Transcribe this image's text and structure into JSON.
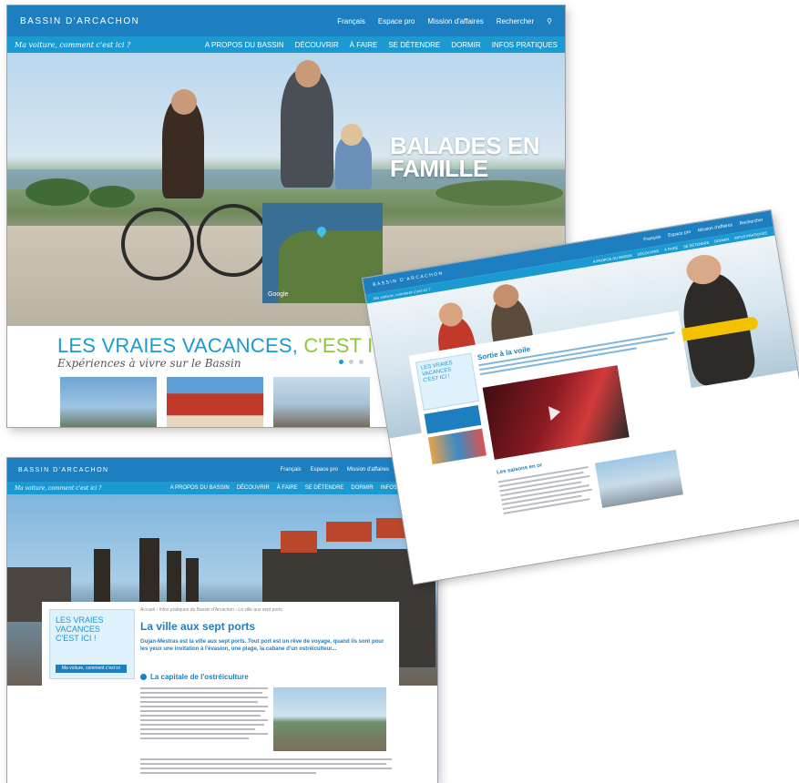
{
  "site": {
    "logo": "BASSIN D'ARCACHON",
    "utils": [
      "Français",
      "Espace pro",
      "Mission d'affaires",
      "Rechercher"
    ],
    "tagline": "Ma voiture, comment c'est ici ?",
    "nav": [
      "A PROPOS DU BASSIN",
      "DÉCOUVRIR",
      "À FAIRE",
      "SE DÉTENDRE",
      "DORMIR",
      "INFOS PRATIQUES"
    ]
  },
  "home": {
    "hero_line1": "BALADES EN",
    "hero_line2": "FAMILLE",
    "map_label": "Google",
    "title_main": "LES VRAIES VACANCES, ",
    "title_accent": "C'EST ICI !",
    "subtitle": "Expériences à vivre sur le Bassin"
  },
  "article_c": {
    "promo_l1": "LES VRAIES",
    "promo_l2": "VACANCES",
    "promo_l3": "C'EST ICI !",
    "promo_button": "Ma voiture, comment c'est ici",
    "breadcrumb": "Accueil  ›  Infos pratiques du Bassin d'Arcachon  ›  La ville aux sept ports",
    "title": "La ville aux sept ports",
    "lead": "Gujan-Mestras est la ville aux sept ports. Tout port est un rêve de voyage, quand ils sont pour les yeux une invitation à l'évasion, une plage, la cabane d'un ostréiculteur...",
    "section": "La capitale de l'ostréiculture"
  },
  "article_b": {
    "promo_l1": "LES VRAIES",
    "promo_l2": "VACANCES",
    "promo_l3": "C'EST ICI !",
    "title": "Sortie à la voile",
    "section": "Les saisons en or"
  }
}
